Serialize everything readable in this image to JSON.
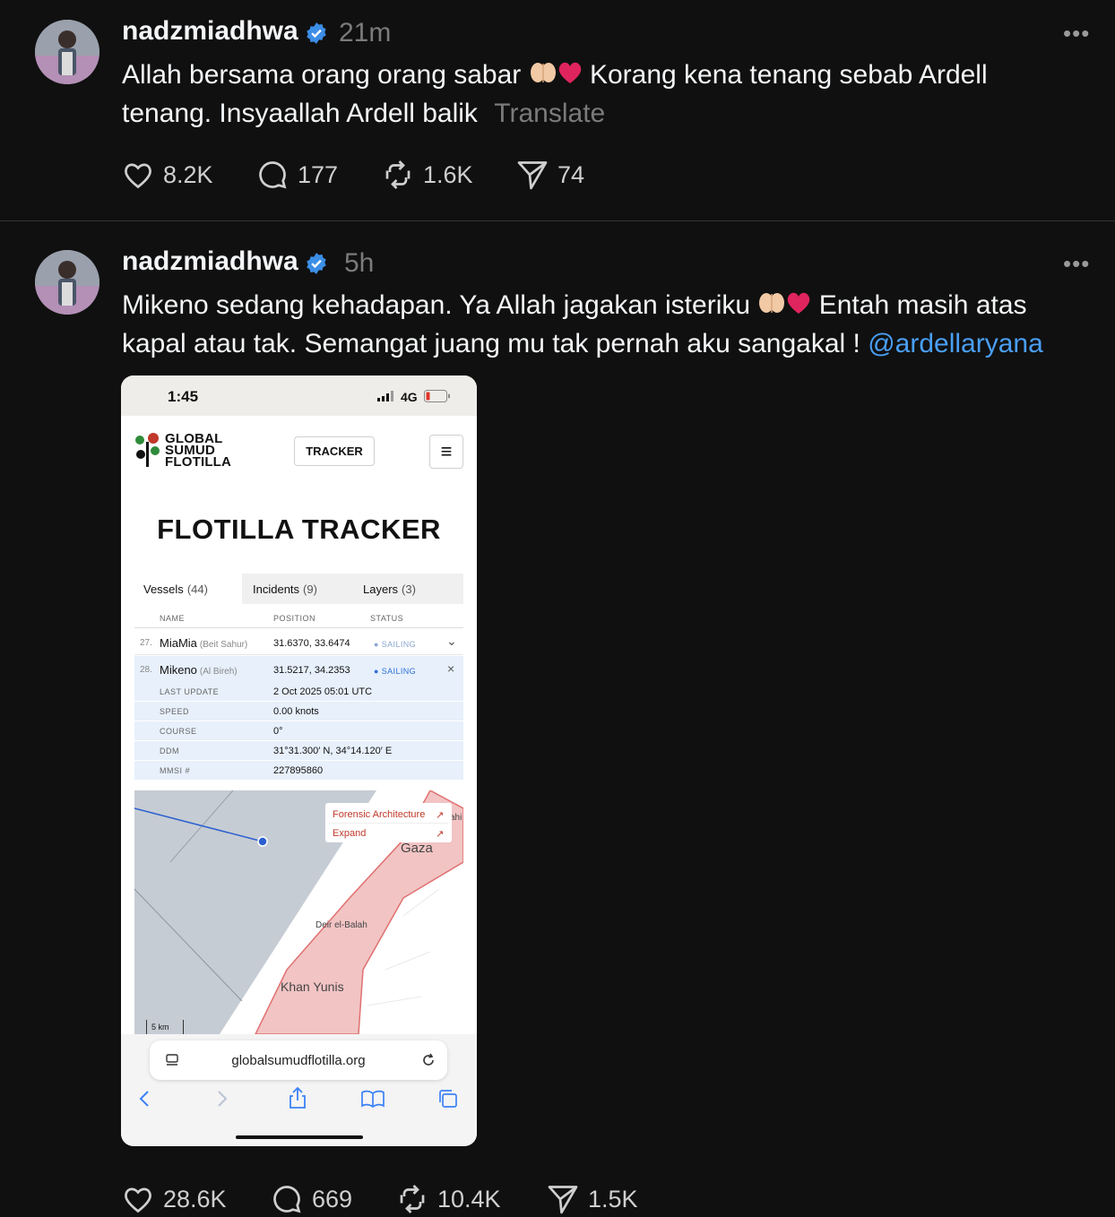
{
  "posts": [
    {
      "username": "nadzmiadhwa",
      "time": "21m",
      "more": "•••",
      "text_line1_a": "Allah bersama orang orang sabar",
      "text_line1_b": "Korang kena tenang sebab Ardell",
      "text_line2": "tenang. Insyaallah Ardell balik",
      "translate": "Translate",
      "likes": "8.2K",
      "replies": "177",
      "reposts": "1.6K",
      "shares": "74"
    },
    {
      "username": "nadzmiadhwa",
      "time": "5h",
      "more": "•••",
      "text_line1_a": "Mikeno sedang kehadapan. Ya Allah jagakan isteriku",
      "text_line1_b": "Entah masih atas",
      "text_line2": "kapal atau tak. Semangat juang mu tak pernah aku sangakal !",
      "mention": "@ardellaryana",
      "likes": "28.6K",
      "replies": "669",
      "reposts": "10.4K",
      "shares": "1.5K"
    }
  ],
  "screenshot": {
    "status_time": "1:45",
    "network": "4G",
    "logo_lines": [
      "GLOBAL",
      "SUMUD",
      "FLOTILLA"
    ],
    "tracker_button": "TRACKER",
    "page_title": "FLOTILLA TRACKER",
    "tabs": [
      {
        "label": "Vessels",
        "count": "(44)"
      },
      {
        "label": "Incidents",
        "count": "(9)"
      },
      {
        "label": "Layers",
        "count": "(3)"
      }
    ],
    "columns": [
      "NAME",
      "POSITION",
      "STATUS"
    ],
    "rows": [
      {
        "idx": "27.",
        "name": "MiaMia",
        "sub": "(Beit Sahur)",
        "position": "31.6370, 33.6474",
        "status": "● SAILING",
        "control": "⌄"
      },
      {
        "idx": "28.",
        "name": "Mikeno",
        "sub": "(Al Bireh)",
        "position": "31.5217, 34.2353",
        "status": "● SAILING",
        "control": "×"
      }
    ],
    "details": [
      {
        "key": "LAST UPDATE",
        "value": "2 Oct 2025 05:01 UTC"
      },
      {
        "key": "SPEED",
        "value": "0.00 knots"
      },
      {
        "key": "COURSE",
        "value": "0°"
      },
      {
        "key": "DDM",
        "value": "31°31.300′ N, 34°14.120′ E"
      },
      {
        "key": "MMSI #",
        "value": "227895860"
      }
    ],
    "map": {
      "popup_1": "Forensic Architecture",
      "popup_2": "Expand",
      "arrow": "↗",
      "label_gaza": "Gaza",
      "label_deir": "Deir el-Balah",
      "label_khan": "Khan Yunis",
      "label_partial": "ahi",
      "scale": "5 km"
    },
    "url": "globalsumudflotilla.org"
  },
  "colors": {
    "background": "#101010",
    "text": "#f3f5f7",
    "muted": "#7b7b7b",
    "mention": "#4a9ff5",
    "verified": "#3c8ee6",
    "heart_emoji": "#e0245e",
    "sailing": "#2f6fd6"
  },
  "icons": [
    "verified-badge-icon",
    "heart-icon",
    "comment-icon",
    "repost-icon",
    "share-icon",
    "praying-hands-emoji",
    "red-heart-emoji"
  ]
}
